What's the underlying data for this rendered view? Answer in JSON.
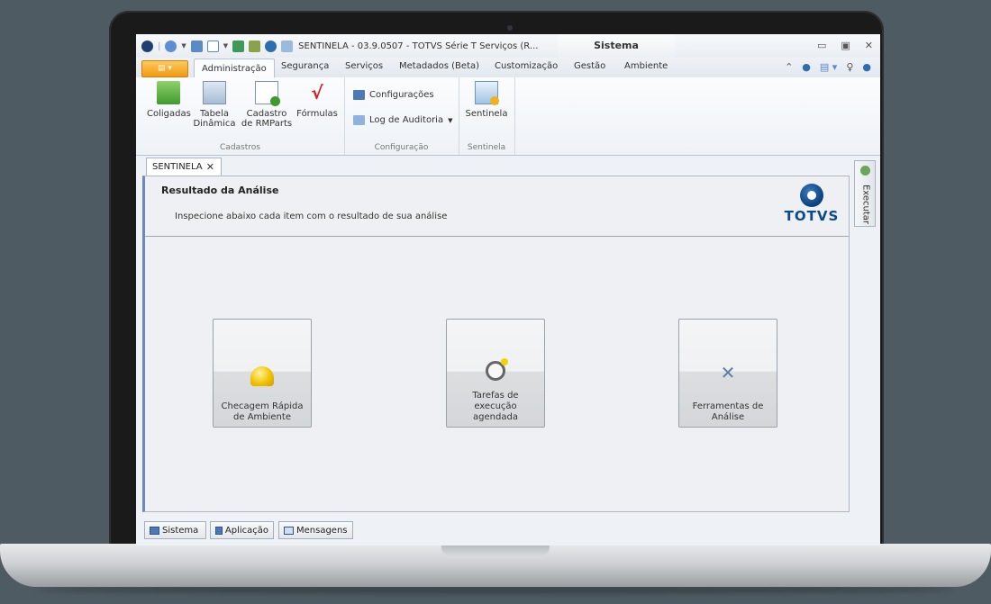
{
  "window": {
    "title": "SENTINELA - 03.9.0507 - TOTVS Série T Serviços (R...",
    "context_tab": "Sistema"
  },
  "ribbon_tabs": [
    "Administração",
    "Segurança",
    "Serviços",
    "Metadados (Beta)",
    "Customização",
    "Gestão",
    "Ambiente"
  ],
  "active_ribbon_tab": "Administração",
  "ribbon": {
    "cadastros": {
      "label": "Cadastros",
      "coligadas": "Coligadas",
      "tabela_1": "Tabela",
      "tabela_2": "Dinâmica",
      "cadastro_1": "Cadastro",
      "cadastro_2": "de RMParts",
      "formulas": "Fórmulas"
    },
    "configuracao": {
      "label": "Configuração",
      "configuracoes": "Configurações",
      "log_auditoria": "Log de Auditoria"
    },
    "sentinela": {
      "label": "Sentinela",
      "button": "Sentinela"
    }
  },
  "doc_tab": {
    "label": "SENTINELA",
    "close": "✕"
  },
  "content": {
    "title": "Resultado da Análise",
    "subtitle": "Inspecione abaixo cada item com o resultado de sua análise",
    "logo_text": "TOTVS"
  },
  "tiles": [
    {
      "line1": "Checagem Rápida",
      "line2": "de Ambiente"
    },
    {
      "line1": "Tarefas de",
      "line2": "execução",
      "line3": "agendada"
    },
    {
      "line1": "Ferramentas de",
      "line2": "Análise"
    }
  ],
  "side_panel": {
    "label": "Executar"
  },
  "status_buttons": [
    "Sistema",
    "Aplicação",
    "Mensagens"
  ],
  "colors": {
    "file_button": "#f19a12",
    "brand_blue": "#0c4a8c",
    "content_border": "#6f88b8"
  }
}
